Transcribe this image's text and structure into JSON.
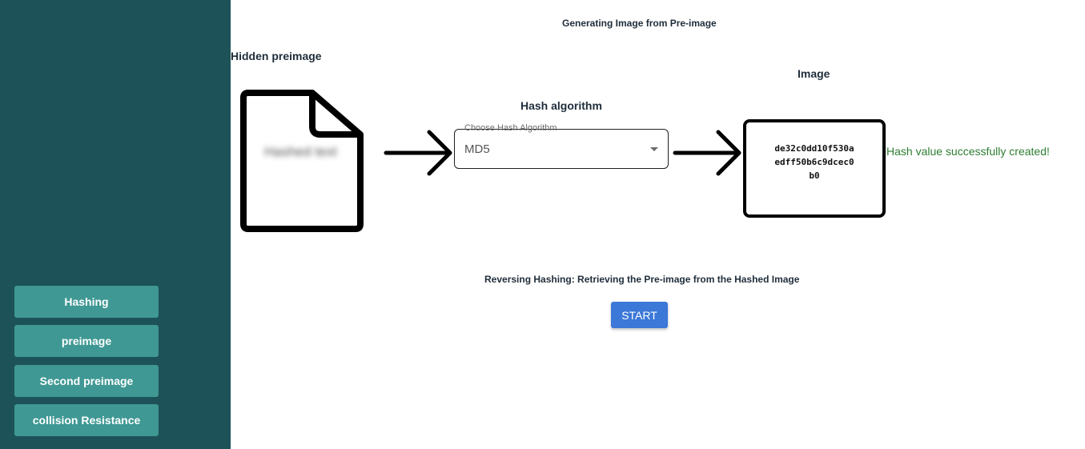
{
  "sidebar": {
    "items": [
      {
        "label": "Hashing"
      },
      {
        "label": "preimage"
      },
      {
        "label": "Second preimage"
      },
      {
        "label": "collision Resistance"
      }
    ]
  },
  "main": {
    "top_title": "Generating Image from Pre-image",
    "hidden_preimage_label": "Hidden preimage",
    "hidden_text": "Hashed text",
    "hash_algorithm_label": "Hash algorithm",
    "select": {
      "label": "Choose Hash Algorithm",
      "value": "MD5"
    },
    "image_label": "Image",
    "hash_lines": [
      "de32c0dd10f530a",
      "edff50b6c9dcec0",
      "b0"
    ],
    "success_message": "Hash value successfully created!",
    "reverse_title": "Reversing Hashing: Retrieving the Pre-image from the Hashed Image",
    "start_label": "START"
  },
  "colors": {
    "sidebar_bg": "#1c5258",
    "nav_button_bg": "#3f9894",
    "start_button_bg": "#3b78d8",
    "success_text": "#2e7d32"
  }
}
